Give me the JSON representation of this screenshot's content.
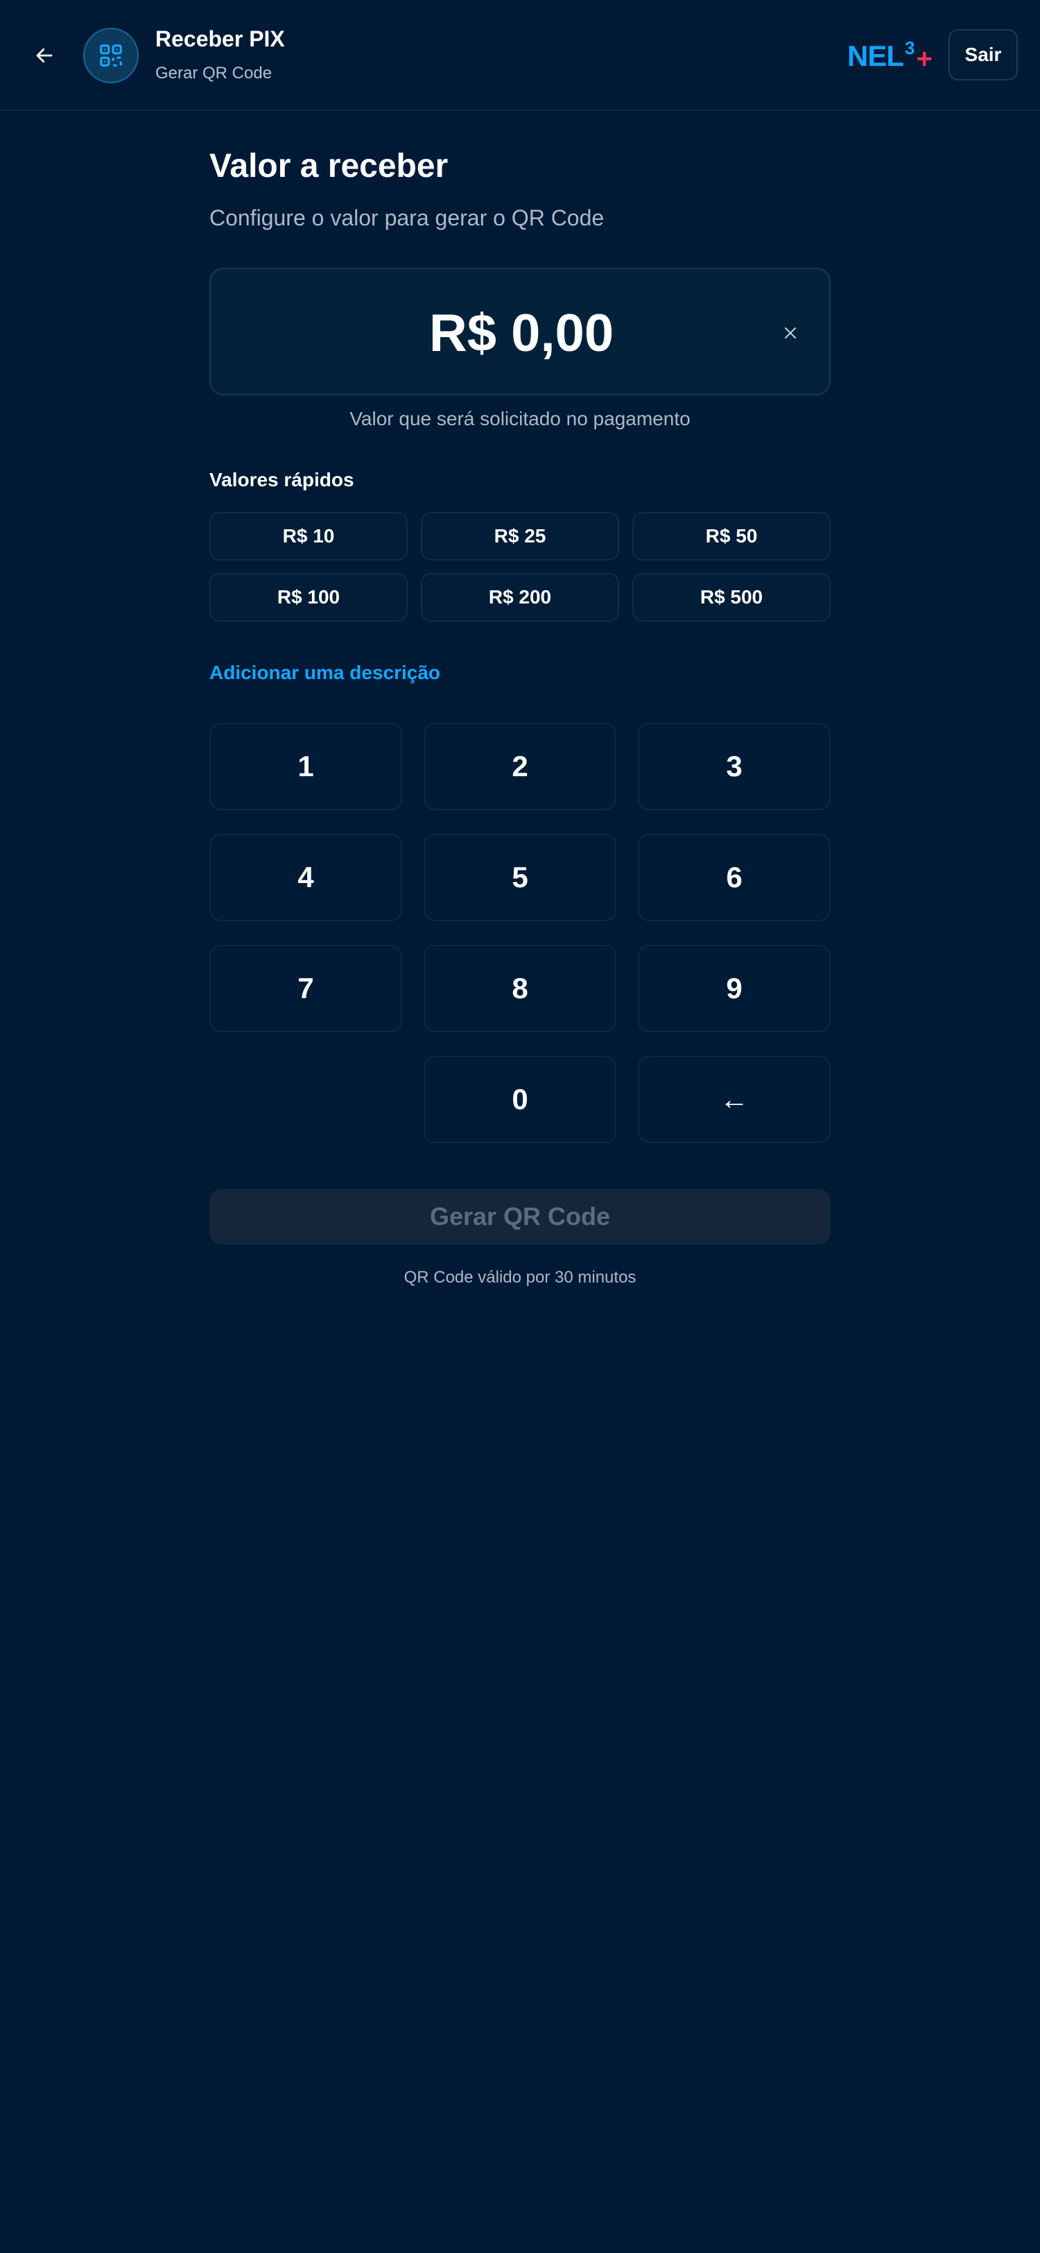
{
  "header": {
    "title": "Receber PIX",
    "subtitle": "Gerar QR Code",
    "logo_text": "NEL",
    "logo_superscript": "3",
    "logo_plus": "+",
    "logout_label": "Sair",
    "back_icon": "arrow-left-icon",
    "avatar_icon": "qr-code-icon"
  },
  "main": {
    "title": "Valor a receber",
    "subtitle": "Configure o valor para gerar o QR Code",
    "amount": "R$ 0,00",
    "amount_hint": "Valor que será solicitado no pagamento",
    "clear_icon": "close-icon",
    "quick_label": "Valores rápidos",
    "quick_values": [
      "R$ 10",
      "R$ 25",
      "R$ 50",
      "R$ 100",
      "R$ 200",
      "R$ 500"
    ],
    "add_description": "Adicionar uma descrição",
    "keypad": [
      "1",
      "2",
      "3",
      "4",
      "5",
      "6",
      "7",
      "8",
      "9",
      "",
      "0",
      "←"
    ],
    "generate_label": "Gerar QR Code",
    "validity_note": "QR Code válido por 30 minutos"
  },
  "colors": {
    "background": "#001a35",
    "accent": "#14a7ff",
    "logo_plus": "#ff2f4b",
    "disabled_button": "#16263a"
  }
}
